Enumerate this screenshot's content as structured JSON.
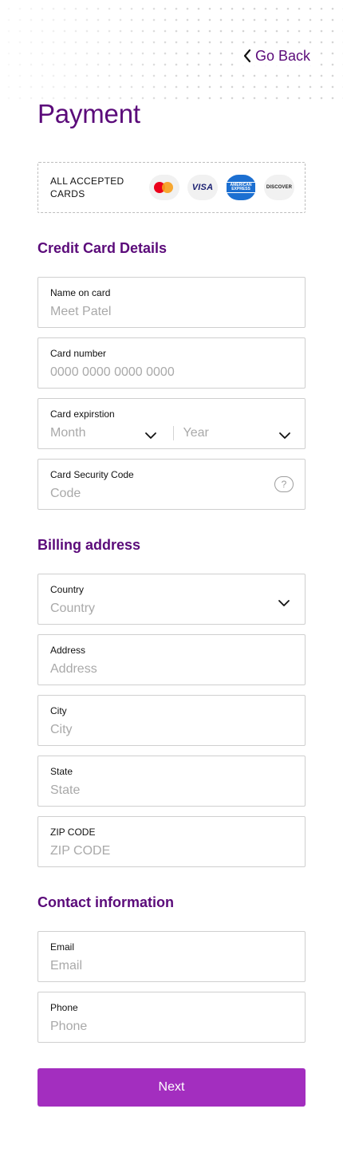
{
  "header": {
    "back_label": "Go Back"
  },
  "page": {
    "title": "Payment"
  },
  "accepted_cards": {
    "label": "ALL ACCEPTED CARDS",
    "logos": [
      {
        "name": "mastercard",
        "text": ""
      },
      {
        "name": "visa",
        "text": "VISA"
      },
      {
        "name": "american-express",
        "text": "AMERICAN EXPRESS"
      },
      {
        "name": "discover",
        "text": "DISCOVER"
      }
    ]
  },
  "credit_card": {
    "section_title": "Credit Card Details",
    "name": {
      "label": "Name on card",
      "placeholder": "Meet Patel"
    },
    "number": {
      "label": "Card number",
      "placeholder": "0000 0000 0000 0000"
    },
    "expiration": {
      "label": "Card expirstion",
      "month_placeholder": "Month",
      "year_placeholder": "Year"
    },
    "security": {
      "label": "Card Security Code",
      "placeholder": "Code",
      "help_glyph": "?"
    }
  },
  "billing": {
    "section_title": "Billing address",
    "country": {
      "label": "Country",
      "placeholder": "Country"
    },
    "address": {
      "label": "Address",
      "placeholder": "Address"
    },
    "city": {
      "label": "City",
      "placeholder": "City"
    },
    "state": {
      "label": "State",
      "placeholder": "State"
    },
    "zip": {
      "label": "ZIP CODE",
      "placeholder": "ZIP CODE"
    }
  },
  "contact": {
    "section_title": "Contact information",
    "email": {
      "label": "Email",
      "placeholder": "Email"
    },
    "phone": {
      "label": "Phone",
      "placeholder": "Phone"
    }
  },
  "actions": {
    "next_label": "Next"
  },
  "colors": {
    "brand_text": "#5b0b7a",
    "button": "#a32ebf",
    "amex": "#1c6fd1"
  }
}
